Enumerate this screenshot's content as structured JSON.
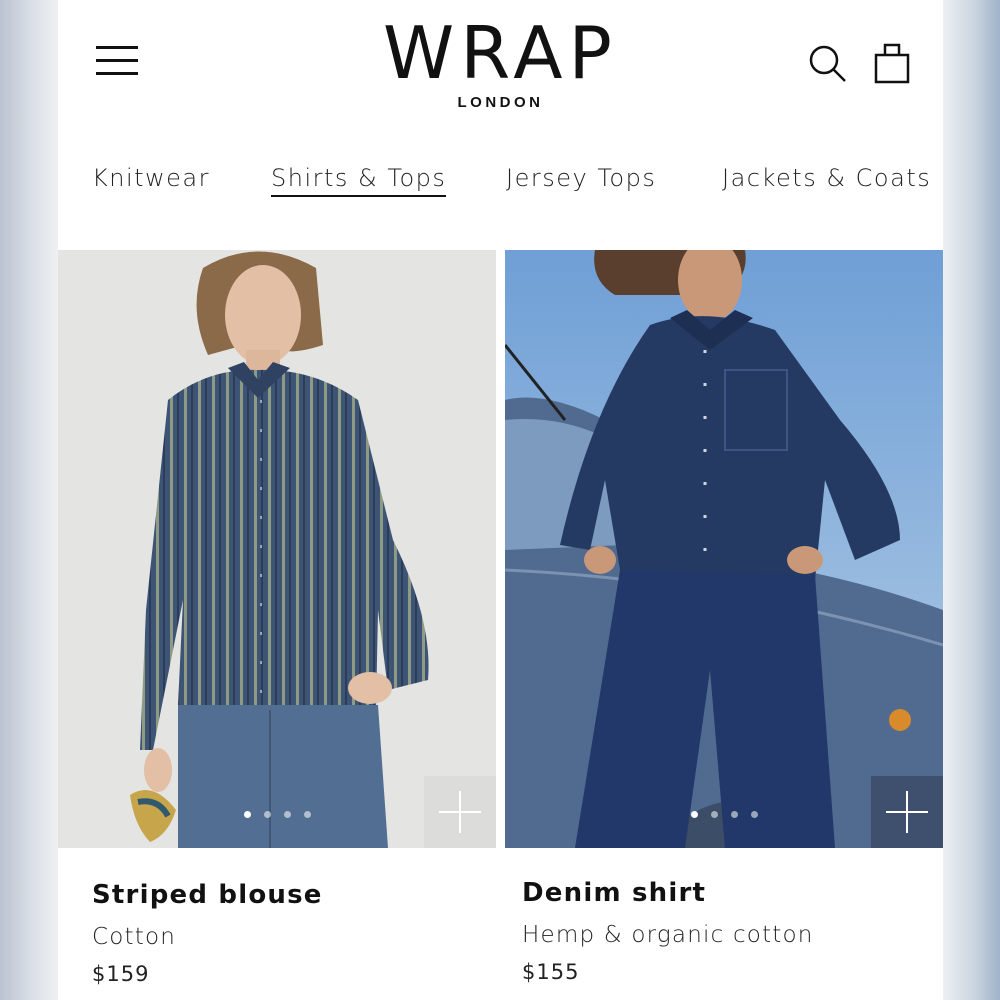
{
  "brand": {
    "name": "WRAP",
    "subtitle": "LONDON"
  },
  "header": {
    "menu_icon": "hamburger-menu-icon",
    "search_icon": "search-icon",
    "bag_icon": "shopping-bag-icon"
  },
  "categories": [
    {
      "label": "Knitwear",
      "active": false
    },
    {
      "label": "Shirts & Tops",
      "active": true
    },
    {
      "label": "Jersey Tops",
      "active": false
    },
    {
      "label": "Jackets & Coats",
      "active": false
    }
  ],
  "products": [
    {
      "name": "Striped blouse",
      "material": "Cotton",
      "price": "$159",
      "image_count": 4,
      "current_image": 1
    },
    {
      "name": "Denim shirt",
      "material": "Hemp & organic cotton",
      "price": "$155",
      "image_count": 4,
      "current_image": 1
    }
  ],
  "colors": {
    "text": "#111111",
    "denim": "#253a63",
    "stripe_shirt": "#3d5474"
  }
}
